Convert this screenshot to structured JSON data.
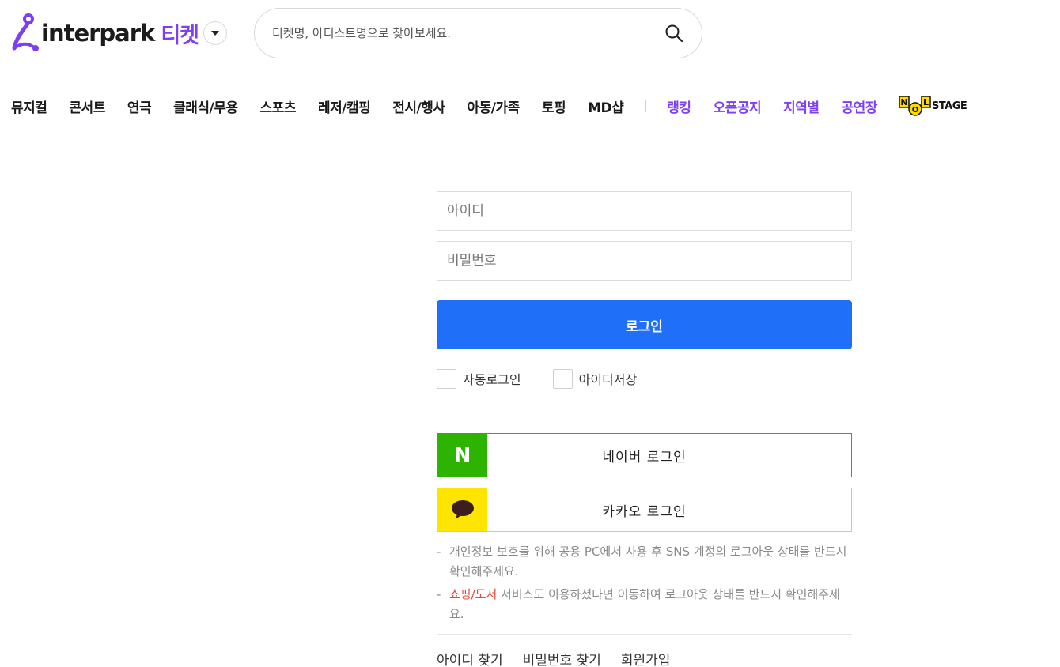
{
  "header": {
    "logo_text": "interpark",
    "logo_suffix": "티켓",
    "search_placeholder": "티켓명, 아티스트명으로 찾아보세요.",
    "accent_color": "#7e3ff2"
  },
  "nav": {
    "items": [
      {
        "label": "뮤지컬"
      },
      {
        "label": "콘서트"
      },
      {
        "label": "연극"
      },
      {
        "label": "클래식/무용"
      },
      {
        "label": "스포츠"
      },
      {
        "label": "레저/캠핑"
      },
      {
        "label": "전시/행사"
      },
      {
        "label": "아동/가족"
      },
      {
        "label": "토핑"
      },
      {
        "label": "MD샵"
      }
    ],
    "highlight_items": [
      {
        "label": "랭킹"
      },
      {
        "label": "오픈공지"
      },
      {
        "label": "지역별"
      },
      {
        "label": "공연장"
      }
    ],
    "nol_stage_label": "STAGE"
  },
  "login": {
    "id_placeholder": "아이디",
    "password_placeholder": "비밀번호",
    "login_button": "로그인",
    "auto_login_label": "자동로그인",
    "save_id_label": "아이디저장",
    "button_color": "#1f6ff9"
  },
  "sns": {
    "naver_label": "네이버 로그인",
    "naver_icon": "N",
    "naver_color": "#2db400",
    "kakao_label": "카카오 로그인",
    "kakao_color": "#fee500"
  },
  "notes": {
    "note1": "개인정보 보호를 위해 공용 PC에서 사용 후 SNS 계정의 로그아웃 상태를 반드시 확인해주세요.",
    "note2_link": "쇼핑/도서",
    "note2_rest": " 서비스도 이용하셨다면 이동하여 로그아웃 상태를 반드시 확인해주세요."
  },
  "links": {
    "find_id": "아이디 찾기",
    "find_password": "비밀번호 찾기",
    "signup": "회원가입"
  }
}
